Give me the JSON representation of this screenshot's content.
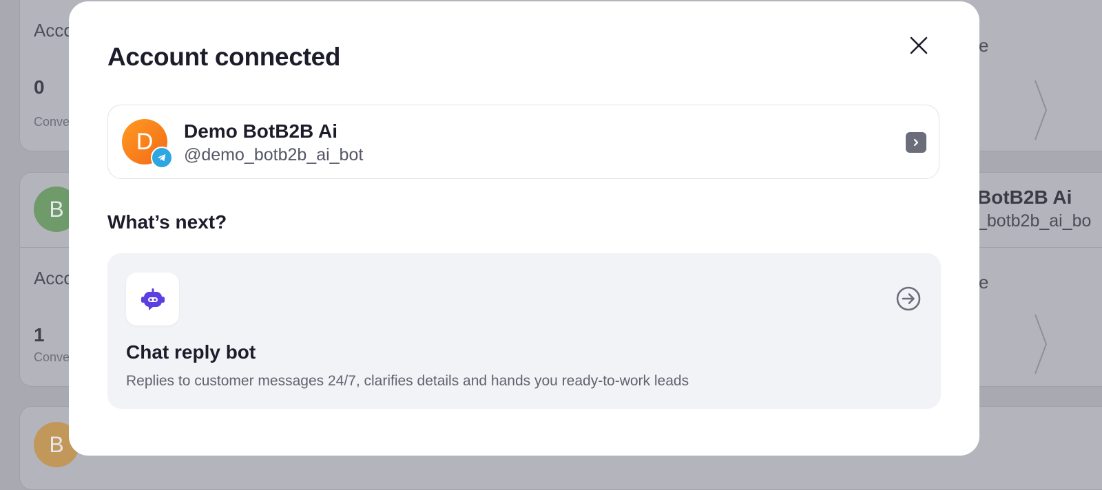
{
  "background": {
    "cards": [
      {
        "heading": "Acco",
        "count": "0",
        "count_label": "Conve",
        "right_label": "e"
      },
      {
        "avatar_letter": "B",
        "right_name": "BotB2B Ai",
        "right_handle": "_botb2b_ai_bo",
        "heading": "Acco",
        "count": "1",
        "count_label": "Conve",
        "right_label": "e"
      },
      {
        "avatar_letter": "B"
      }
    ]
  },
  "modal": {
    "title": "Account connected",
    "close_icon": "close-icon",
    "account": {
      "avatar_letter": "D",
      "name": "Demo BotB2B Ai",
      "handle": "@demo_botb2b_ai_bot",
      "badge_icon": "telegram-icon",
      "arrow_icon": "chevron-right-icon"
    },
    "next_title": "What’s next?",
    "feature": {
      "icon": "robot-icon",
      "title": "Chat reply bot",
      "description": "Replies to customer messages 24/7, clarifies details and hands you ready-to-work leads",
      "arrow_icon": "arrow-right-circle-icon"
    }
  },
  "colors": {
    "accent": "#5b3fe0",
    "telegram": "#2ea6e1",
    "avatar_orange": "#f47a1a",
    "overlay": "#a9aab1"
  }
}
